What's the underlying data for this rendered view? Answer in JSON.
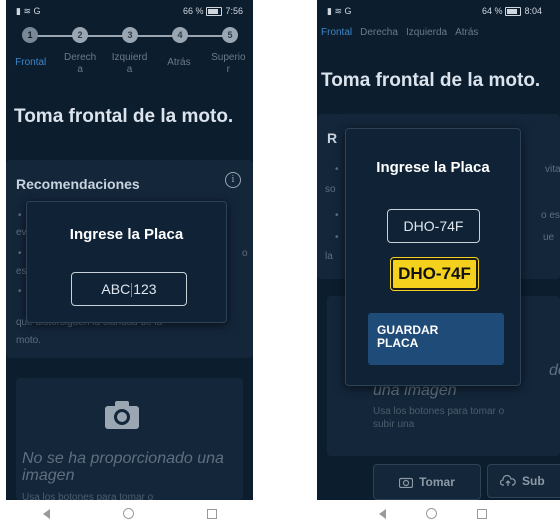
{
  "screen1": {
    "status": {
      "left_icons": "▮ ≋ G",
      "battery": "66 %",
      "time": "7:56"
    },
    "steps": [
      "1",
      "2",
      "3",
      "4",
      "5"
    ],
    "tabs": [
      "Frontal",
      "Derecha",
      "Izquierda",
      "Atrás",
      "Superior"
    ],
    "tabs_wrapped": [
      [
        "Frontal"
      ],
      [
        "Derech",
        "a"
      ],
      [
        "Izquierd",
        "a"
      ],
      [
        "Atrás"
      ],
      [
        "Superio",
        "r"
      ]
    ],
    "page_title": "Toma frontal de la moto.",
    "recommendations": {
      "title": "Recomendaciones",
      "line_fragments": [
        "•",
        "ev",
        "•",
        "o",
        "es",
        "•",
        "que distorsiguen la claridad de la",
        "moto."
      ]
    },
    "dialog": {
      "title": "Ingrese la Placa",
      "input_before_caret": "ABC",
      "input_after_caret": "123"
    },
    "image_card": {
      "no_image": "No se ha proporcionado una imagen",
      "subtext": "Usa los botones para tomar o"
    }
  },
  "screen2": {
    "status": {
      "left_icons": "▮ ≋ G",
      "battery": "64 %",
      "time": "8:04"
    },
    "tabs": [
      "Frontal",
      "Derecha",
      "Izquierda",
      "Atrás"
    ],
    "page_title": "Toma frontal de la moto.",
    "recommendations": {
      "title_fragment": "R",
      "line_fragments": [
        "•",
        "vita",
        "so",
        "•",
        "o es",
        "•",
        "ue",
        "la"
      ]
    },
    "dialog": {
      "title": "Ingrese la Placa",
      "input_value": "DHO-74F",
      "plate_preview": "DHO-74F",
      "save_label_line1": "GUARDAR",
      "save_label_line2": "PLACA"
    },
    "image_card": {
      "no_image_fragment": "do",
      "no_image_line2": "una imagen",
      "subtext_line1": "Usa los botones para tomar o",
      "subtext_line2": "subir una"
    },
    "buttons": {
      "take": "Tomar",
      "upload": "Sub"
    }
  },
  "colors": {
    "background": "#0c1d2e",
    "card": "#13263a",
    "accent": "#3f86c8",
    "plate_yellow": "#f3d11c",
    "save_button": "#1f4b78"
  },
  "icons": [
    "step-circle",
    "info-icon",
    "camera-icon",
    "upload-cloud-icon",
    "nav-back-icon",
    "nav-home-icon",
    "nav-recent-icon"
  ]
}
